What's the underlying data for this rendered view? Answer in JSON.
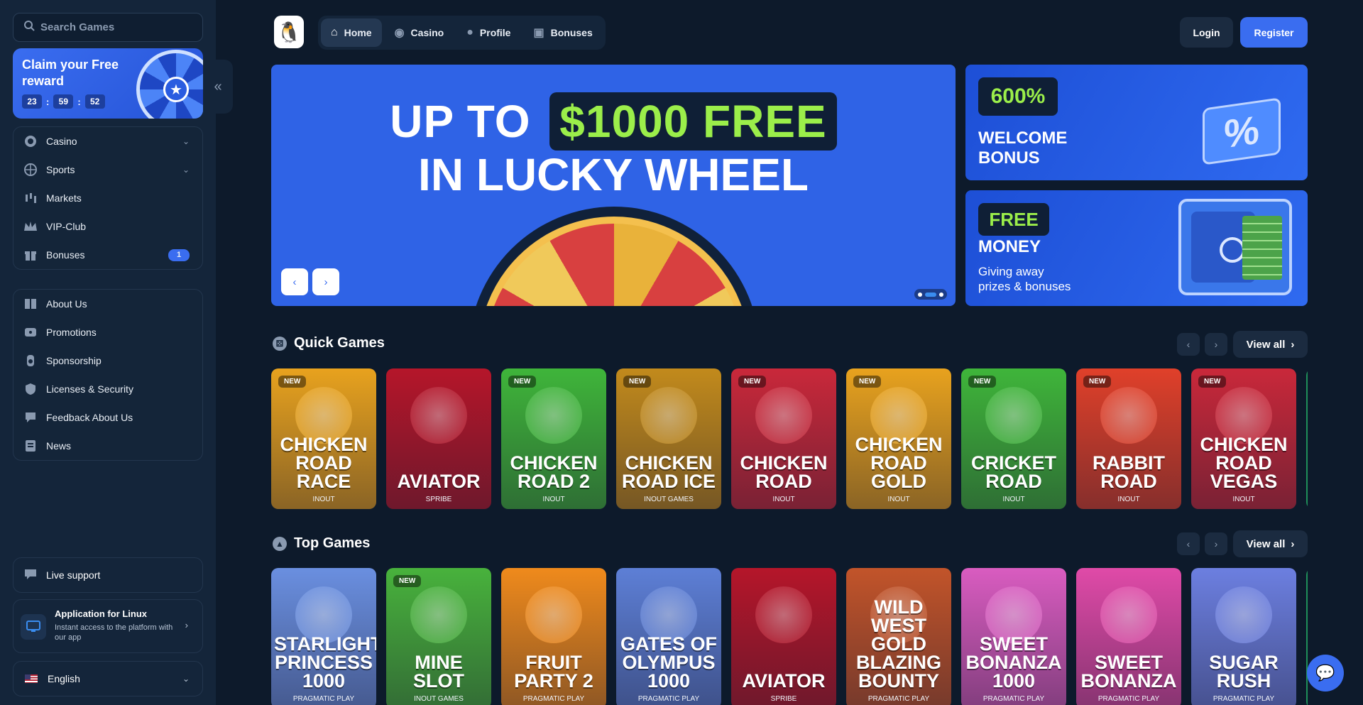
{
  "sidebar": {
    "search_placeholder": "Search Games",
    "reward": {
      "title": "Claim your Free reward",
      "hours": "23",
      "minutes": "59",
      "seconds": "52"
    },
    "main_menu": [
      {
        "label": "Casino",
        "icon": "casino-chip-icon",
        "expandable": true
      },
      {
        "label": "Sports",
        "icon": "globe-ball-icon",
        "expandable": true
      },
      {
        "label": "Markets",
        "icon": "candlestick-icon"
      },
      {
        "label": "VIP-Club",
        "icon": "crown-icon"
      },
      {
        "label": "Bonuses",
        "icon": "gift-icon",
        "badge": "1"
      }
    ],
    "info_menu": [
      {
        "label": "About Us",
        "icon": "book-icon"
      },
      {
        "label": "Promotions",
        "icon": "ticket-icon"
      },
      {
        "label": "Sponsorship",
        "icon": "trophy-icon"
      },
      {
        "label": "Licenses & Security",
        "icon": "shield-icon"
      },
      {
        "label": "Feedback About Us",
        "icon": "feedback-icon"
      },
      {
        "label": "News",
        "icon": "newspaper-icon"
      }
    ],
    "live_support": "Live support",
    "app": {
      "title": "Application for Linux",
      "desc": "Instant access to the platform with our app"
    },
    "language": "English"
  },
  "nav": {
    "items": [
      {
        "label": "Home",
        "icon": "home-icon",
        "active": true
      },
      {
        "label": "Casino",
        "icon": "casino-chip-icon"
      },
      {
        "label": "Profile",
        "icon": "user-icon"
      },
      {
        "label": "Bonuses",
        "icon": "gift-icon"
      }
    ],
    "login": "Login",
    "register": "Register"
  },
  "hero": {
    "line1_a": "UP TO",
    "line1_b": "$1000 FREE",
    "line2": "IN LUCKY WHEEL",
    "prev": "‹",
    "next": "›"
  },
  "promos": {
    "welcome": {
      "tag": "600%",
      "text1": "WELCOME",
      "text2": "BONUS"
    },
    "money": {
      "tag": "FREE",
      "text": "MONEY",
      "sub1": "Giving away",
      "sub2": "prizes & bonuses"
    }
  },
  "quick_games": {
    "title": "Quick Games",
    "view_all": "View all",
    "games": [
      {
        "name1": "CHICKEN",
        "name2": "ROAD RACE",
        "provider": "INOUT",
        "new": true,
        "color": "#e8a21e"
      },
      {
        "name1": "",
        "name2": "AVIATOR",
        "provider": "SPRIBE",
        "new": false,
        "color": "#b5162a"
      },
      {
        "name1": "CHICKEN",
        "name2": "ROAD 2",
        "provider": "INOUT",
        "new": true,
        "color": "#3fb53a"
      },
      {
        "name1": "CHICKEN",
        "name2": "ROAD ICE",
        "provider": "INOUT GAMES",
        "new": true,
        "color": "#c28a1c"
      },
      {
        "name1": "CHICKEN",
        "name2": "ROAD",
        "provider": "INOUT",
        "new": true,
        "color": "#c9283a"
      },
      {
        "name1": "CHICKEN",
        "name2": "ROAD GOLD",
        "provider": "INOUT",
        "new": true,
        "color": "#e8a21e"
      },
      {
        "name1": "CRICKET",
        "name2": "ROAD",
        "provider": "INOUT",
        "new": true,
        "color": "#3fb53a"
      },
      {
        "name1": "RABBIT",
        "name2": "ROAD",
        "provider": "INOUT",
        "new": true,
        "color": "#e0402a"
      },
      {
        "name1": "CHICKEN",
        "name2": "ROAD VEGAS",
        "provider": "INOUT",
        "new": true,
        "color": "#c9283a"
      }
    ]
  },
  "top_games": {
    "title": "Top Games",
    "view_all": "View all",
    "games": [
      {
        "name1": "STARLIGHT",
        "name2": "PRINCESS 1000",
        "provider": "PRAGMATIC PLAY",
        "new": false,
        "color": "#6a8fe0"
      },
      {
        "name1": "MINE",
        "name2": "SLOT",
        "provider": "INOUT GAMES",
        "new": true,
        "color": "#48b23c"
      },
      {
        "name1": "FRUIT",
        "name2": "PARTY 2",
        "provider": "PRAGMATIC PLAY",
        "new": false,
        "color": "#ef8a1c"
      },
      {
        "name1": "GATES OF",
        "name2": "OLYMPUS 1000",
        "provider": "PRAGMATIC PLAY",
        "new": false,
        "color": "#5d7fd6"
      },
      {
        "name1": "",
        "name2": "AVIATOR",
        "provider": "SPRIBE",
        "new": false,
        "color": "#b5162a"
      },
      {
        "name1": "WILD WEST GOLD",
        "name2": "BLAZING BOUNTY",
        "provider": "PRAGMATIC PLAY",
        "new": false,
        "color": "#c2542a"
      },
      {
        "name1": "SWEET",
        "name2": "BONANZA 1000",
        "provider": "PRAGMATIC PLAY",
        "new": false,
        "color": "#d95cc0"
      },
      {
        "name1": "SWEET",
        "name2": "BONANZA",
        "provider": "PRAGMATIC PLAY",
        "new": false,
        "color": "#e04aa8"
      },
      {
        "name1": "SUGAR",
        "name2": "RUSH",
        "provider": "PRAGMATIC PLAY",
        "new": false,
        "color": "#6c7fe0"
      }
    ]
  }
}
